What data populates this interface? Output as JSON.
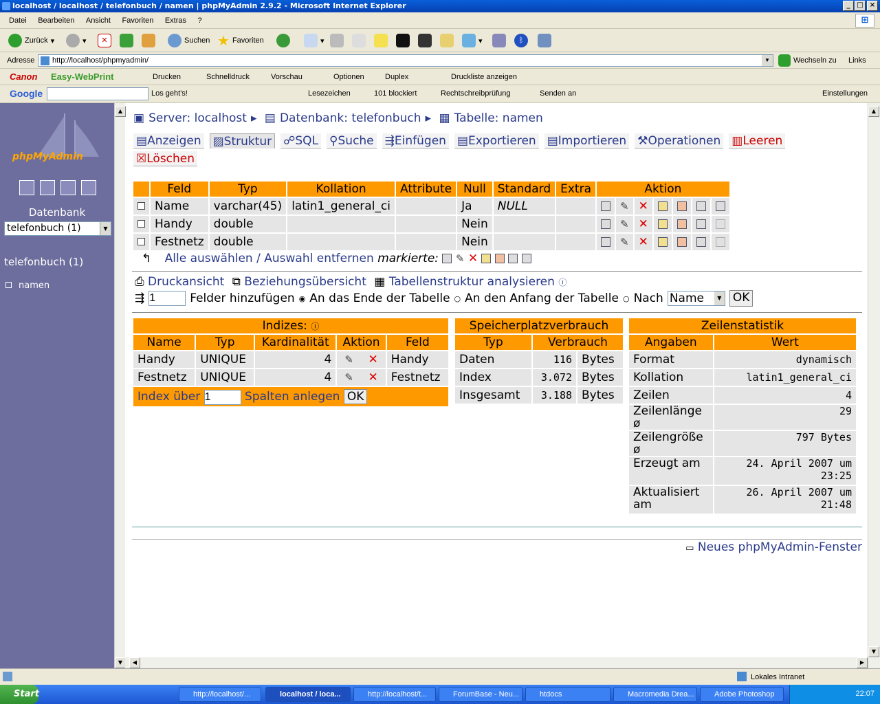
{
  "window": {
    "title": "localhost / localhost / telefonbuch / namen | phpMyAdmin 2.9.2 - Microsoft Internet Explorer"
  },
  "menu": [
    "Datei",
    "Bearbeiten",
    "Ansicht",
    "Favoriten",
    "Extras",
    "?"
  ],
  "toolbar": {
    "back": "Zurück",
    "search": "Suchen",
    "favorites": "Favoriten"
  },
  "address": {
    "label": "Adresse",
    "url": "http://localhost/phpmyadmin/",
    "go": "Wechseln zu",
    "links": "Links"
  },
  "canon": {
    "brand": "Canon",
    "app": "Easy-WebPrint",
    "print": "Drucken",
    "quick": "Schnelldruck",
    "preview": "Vorschau",
    "options": "Optionen",
    "duplex": "Duplex",
    "list": "Druckliste anzeigen"
  },
  "google": {
    "brand": "Google",
    "go": "Los geht's!",
    "bookmarks": "Lesezeichen",
    "blocked": "101 blockiert",
    "spell": "Rechtschreibprüfung",
    "send": "Senden an",
    "settings": "Einstellungen"
  },
  "left": {
    "logo": "phpMyAdmin",
    "db_label": "Datenbank",
    "db_select": "telefonbuch (1)",
    "db_link": "telefonbuch (1)",
    "table": "namen"
  },
  "crumbs": {
    "server": "Server: localhost",
    "database": "Datenbank: telefonbuch",
    "table": "Tabelle: namen"
  },
  "tabs": [
    "Anzeigen",
    "Struktur",
    "SQL",
    "Suche",
    "Einfügen",
    "Exportieren",
    "Importieren",
    "Operationen",
    "Leeren",
    "Löschen"
  ],
  "fields": {
    "headers": [
      "Feld",
      "Typ",
      "Kollation",
      "Attribute",
      "Null",
      "Standard",
      "Extra",
      "Aktion"
    ],
    "rows": [
      {
        "name": "Name",
        "type": "varchar(45)",
        "collation": "latin1_general_ci",
        "attr": "",
        "null": "Ja",
        "default": "NULL",
        "extra": ""
      },
      {
        "name": "Handy",
        "type": "double",
        "collation": "",
        "attr": "",
        "null": "Nein",
        "default": "",
        "extra": ""
      },
      {
        "name": "Festnetz",
        "type": "double",
        "collation": "",
        "attr": "",
        "null": "Nein",
        "default": "",
        "extra": ""
      }
    ],
    "select_all": "Alle auswählen",
    "sep": "/",
    "deselect": "Auswahl entfernen",
    "marked": "markierte:"
  },
  "links": {
    "print": "Druckansicht",
    "relations": "Beziehungsübersicht",
    "analyze": "Tabellenstruktur analysieren"
  },
  "addfields": {
    "count": "1",
    "label": "Felder hinzufügen",
    "end": "An das Ende der Tabelle",
    "start": "An den Anfang der Tabelle",
    "after": "Nach",
    "after_select": "Name",
    "ok": "OK"
  },
  "indexes": {
    "title": "Indizes:",
    "headers": [
      "Name",
      "Typ",
      "Kardinalität",
      "Aktion",
      "Feld"
    ],
    "rows": [
      {
        "name": "Handy",
        "type": "UNIQUE",
        "card": "4",
        "field": "Handy"
      },
      {
        "name": "Festnetz",
        "type": "UNIQUE",
        "card": "4",
        "field": "Festnetz"
      }
    ],
    "create_prefix": "Index über",
    "create_count": "1",
    "create_suffix": "Spalten anlegen",
    "ok": "OK"
  },
  "space": {
    "title": "Speicherplatzverbrauch",
    "headers": [
      "Typ",
      "Verbrauch"
    ],
    "rows": [
      {
        "type": "Daten",
        "value": "116",
        "unit": "Bytes"
      },
      {
        "type": "Index",
        "value": "3.072",
        "unit": "Bytes"
      },
      {
        "type": "Insgesamt",
        "value": "3.188",
        "unit": "Bytes"
      }
    ]
  },
  "stats": {
    "title": "Zeilenstatistik",
    "headers": [
      "Angaben",
      "Wert"
    ],
    "rows": [
      {
        "label": "Format",
        "value": "dynamisch"
      },
      {
        "label": "Kollation",
        "value": "latin1_general_ci"
      },
      {
        "label": "Zeilen",
        "value": "4"
      },
      {
        "label": "Zeilenlänge ø",
        "value": "29"
      },
      {
        "label": "Zeilengröße ø",
        "value": "797 Bytes"
      },
      {
        "label": "Erzeugt am",
        "value": "24. April 2007 um 23:25"
      },
      {
        "label": "Aktualisiert am",
        "value": "26. April 2007 um 21:48"
      }
    ]
  },
  "newwindow": "Neues phpMyAdmin-Fenster",
  "status": {
    "zone": "Lokales Intranet"
  },
  "taskbar": {
    "start": "Start",
    "tasks": [
      "http://localhost/...",
      "localhost / loca...",
      "http://localhost/t...",
      "ForumBase - Neu...",
      "htdocs",
      "Macromedia Drea...",
      "Adobe Photoshop"
    ],
    "clock": "22:07"
  }
}
